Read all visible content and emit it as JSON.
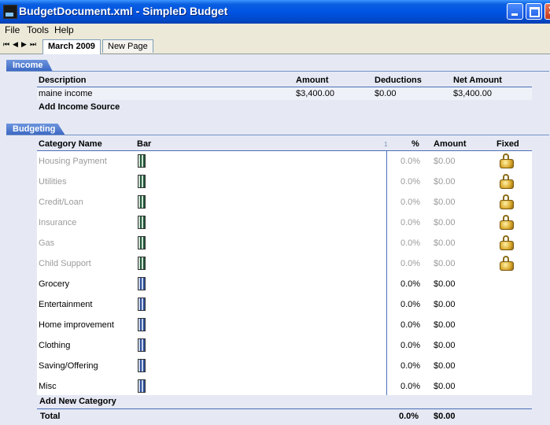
{
  "window": {
    "title": "BudgetDocument.xml - SimpleD Budget"
  },
  "menu": [
    "File",
    "Tools",
    "Help"
  ],
  "nav": [
    "⏮",
    "◀",
    "▶",
    "⏭"
  ],
  "tabs": [
    "March 2009",
    "New Page"
  ],
  "income": {
    "section_title": "Income",
    "columns": [
      "Description",
      "Amount",
      "Deductions",
      "Net Amount"
    ],
    "rows": [
      {
        "description": "maine income",
        "amount": "$3,400.00",
        "deductions": "$0.00",
        "net": "$3,400.00"
      }
    ],
    "add_label": "Add Income Source"
  },
  "budgeting": {
    "section_title": "Budgeting",
    "columns": {
      "category": "Category Name",
      "bar": "Bar",
      "marker": "1",
      "pct": "%",
      "amount": "Amount",
      "fixed": "Fixed"
    },
    "rows": [
      {
        "name": "Housing Payment",
        "pct": "0.0%",
        "amount": "$0.00",
        "fixed": true
      },
      {
        "name": "Utilities",
        "pct": "0.0%",
        "amount": "$0.00",
        "fixed": true
      },
      {
        "name": "Credit/Loan",
        "pct": "0.0%",
        "amount": "$0.00",
        "fixed": true
      },
      {
        "name": "Insurance",
        "pct": "0.0%",
        "amount": "$0.00",
        "fixed": true
      },
      {
        "name": "Gas",
        "pct": "0.0%",
        "amount": "$0.00",
        "fixed": true
      },
      {
        "name": "Child Support",
        "pct": "0.0%",
        "amount": "$0.00",
        "fixed": true
      },
      {
        "name": "Grocery",
        "pct": "0.0%",
        "amount": "$0.00",
        "fixed": false
      },
      {
        "name": "Entertainment",
        "pct": "0.0%",
        "amount": "$0.00",
        "fixed": false
      },
      {
        "name": "Home improvement",
        "pct": "0.0%",
        "amount": "$0.00",
        "fixed": false
      },
      {
        "name": "Clothing",
        "pct": "0.0%",
        "amount": "$0.00",
        "fixed": false
      },
      {
        "name": "Saving/Offering",
        "pct": "0.0%",
        "amount": "$0.00",
        "fixed": false
      },
      {
        "name": "Misc",
        "pct": "0.0%",
        "amount": "$0.00",
        "fixed": false
      }
    ],
    "add_label": "Add New Category",
    "total": {
      "label": "Total",
      "pct": "0.0%",
      "amount": "$0.00"
    }
  },
  "colors": {
    "titlebar": "#0054e3",
    "section_header": "#3c69c3",
    "content_bg": "#e6e9f4",
    "fixed_text": "#9b9b9b"
  }
}
